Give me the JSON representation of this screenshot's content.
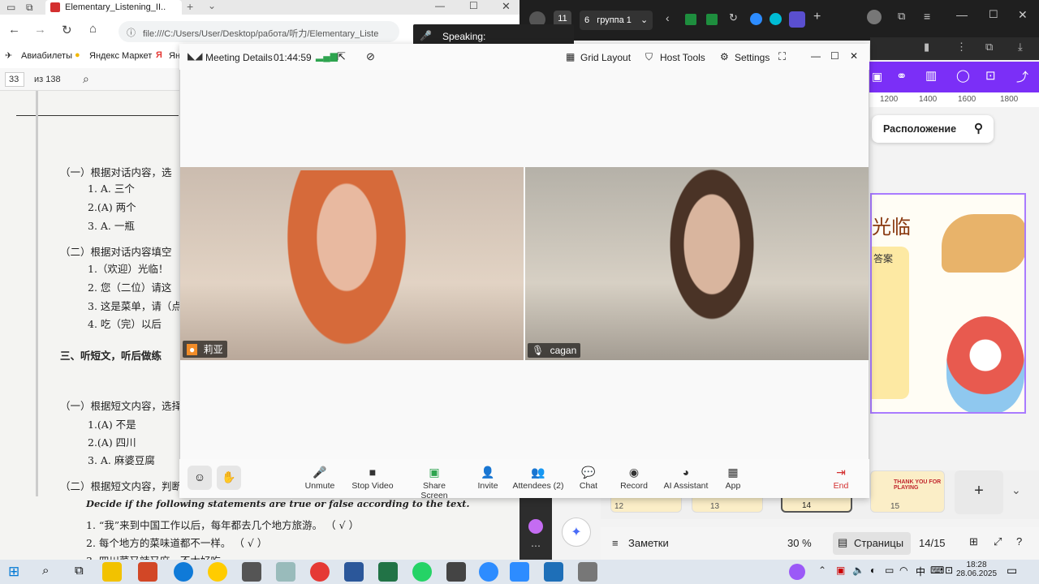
{
  "browser": {
    "tab_title": "Elementary_Listening_II..",
    "url": "file:///C:/Users/User/Desktop/работа/听力/Elementary_Liste",
    "bookmarks": [
      "Авиабилеты",
      "Яндекс Маркет",
      "Ян"
    ],
    "pdf_page": "33",
    "pdf_total": "из 138"
  },
  "pdf": {
    "lines": [
      "（一）根据对话内容，选",
      "1. A. 三个",
      "2.(A) 两个",
      "3. A. 一瓶",
      "（二）根据对话内容填空",
      "1.（欢迎）光临！",
      "2. 您（二位）请这",
      "3. 这是菜单，请（点",
      "4. 吃（完）以后",
      "三、听短文，听后做练",
      "（一）根据短文内容，选择",
      "1.(A) 不是",
      "2.(A) 四川",
      "3. A. 麻婆豆腐",
      "（二）根据短文内容，判断"
    ],
    "bottom_lines": [
      "Decide if the following statements are true or false according to the text.",
      "1. “我”来到中国工作以后，每年都去几个地方旅游。 （ √ ）",
      "2. 每个地方的菜味道都不一样。 （ √ ）",
      "3. 四川菜又辣又麻，不太好吃"
    ]
  },
  "speaking": {
    "label": "Speaking:"
  },
  "zoom": {
    "meeting_details": "Meeting Details",
    "timer": "01:44:59",
    "layout": "Grid Layout",
    "host_tools": "Host Tools",
    "settings": "Settings",
    "participants": [
      {
        "name": "莉亚"
      },
      {
        "name": "cagan"
      }
    ],
    "toolbar": [
      {
        "label": "Unmute"
      },
      {
        "label": "Stop Video"
      },
      {
        "label": "Share Screen"
      },
      {
        "label": "Invite"
      },
      {
        "label": "Attendees (2)"
      },
      {
        "label": "Chat"
      },
      {
        "label": "Record"
      },
      {
        "label": "AI Assistant"
      },
      {
        "label": "App"
      },
      {
        "label": "End"
      }
    ]
  },
  "rightapp": {
    "tab_count": "11",
    "group_count": "6",
    "group_name": "группа 1",
    "ruler": [
      "1200",
      "1400",
      "1600",
      "1800"
    ],
    "layout_label": "Расположение",
    "slide_title": "光临",
    "slide_box": "答案",
    "thumbs": [
      "12",
      "13",
      "14",
      "15"
    ],
    "thumb_15_text": "THANK YOU FOR PLAYING",
    "notes_label": "Заметки",
    "zoom_level": "30 %",
    "pages_label": "Страницы",
    "page_indicator": "14/15"
  },
  "taskbar": {
    "time": "18:28",
    "date": "28.06.2025"
  }
}
